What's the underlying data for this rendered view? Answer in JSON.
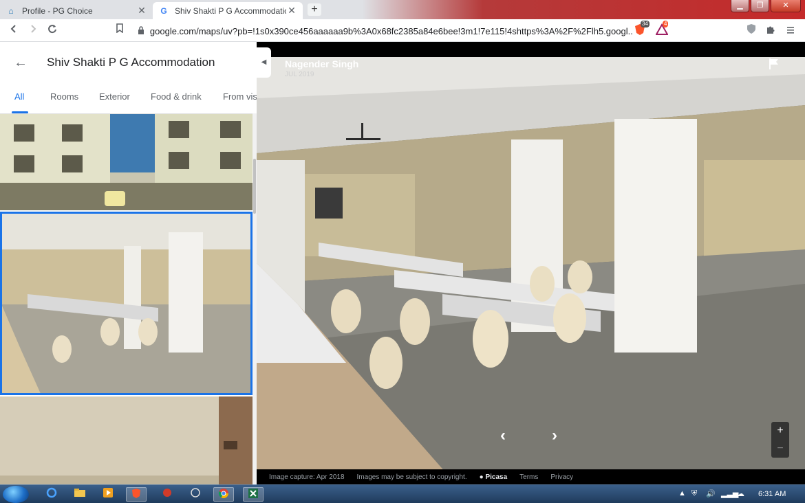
{
  "browser": {
    "tabs": [
      {
        "title": "Profile - PG Choice",
        "close": "✕",
        "favicon": "⌂"
      },
      {
        "title": "Shiv Shakti P G Accommodation A",
        "close": "✕",
        "favicon": "G"
      }
    ],
    "new_tab": "+",
    "window_buttons": {
      "min": "▁",
      "max": "❐",
      "close": "✕"
    },
    "url": "google.com/maps/uv?pb=!1s0x390ce456aaaaaa9b%3A0x68fc2385a84e6bee!3m1!7e115!4shttps%3A%2F%2Flh5.googl...",
    "badges": {
      "brave_count": "34",
      "bat_count": "4"
    }
  },
  "place": {
    "back_icon": "←",
    "title": "Shiv Shakti P G Accommodation",
    "tabs": [
      {
        "label": "All"
      },
      {
        "label": "Rooms"
      },
      {
        "label": "Exterior"
      },
      {
        "label": "Food & drink"
      },
      {
        "label": "From vis"
      }
    ]
  },
  "viewer": {
    "author": "Nagender Singh",
    "date": "JUL 2019",
    "prev": "‹",
    "next": "›",
    "zoom_in": "+",
    "zoom_out": "−",
    "footer": {
      "capture": "Image capture: Apr 2018",
      "copyright": "Images may be subject to copyright.",
      "picasa": "Picasa",
      "terms": "Terms",
      "privacy": "Privacy"
    }
  },
  "taskbar": {
    "clock": "6:31 AM"
  }
}
